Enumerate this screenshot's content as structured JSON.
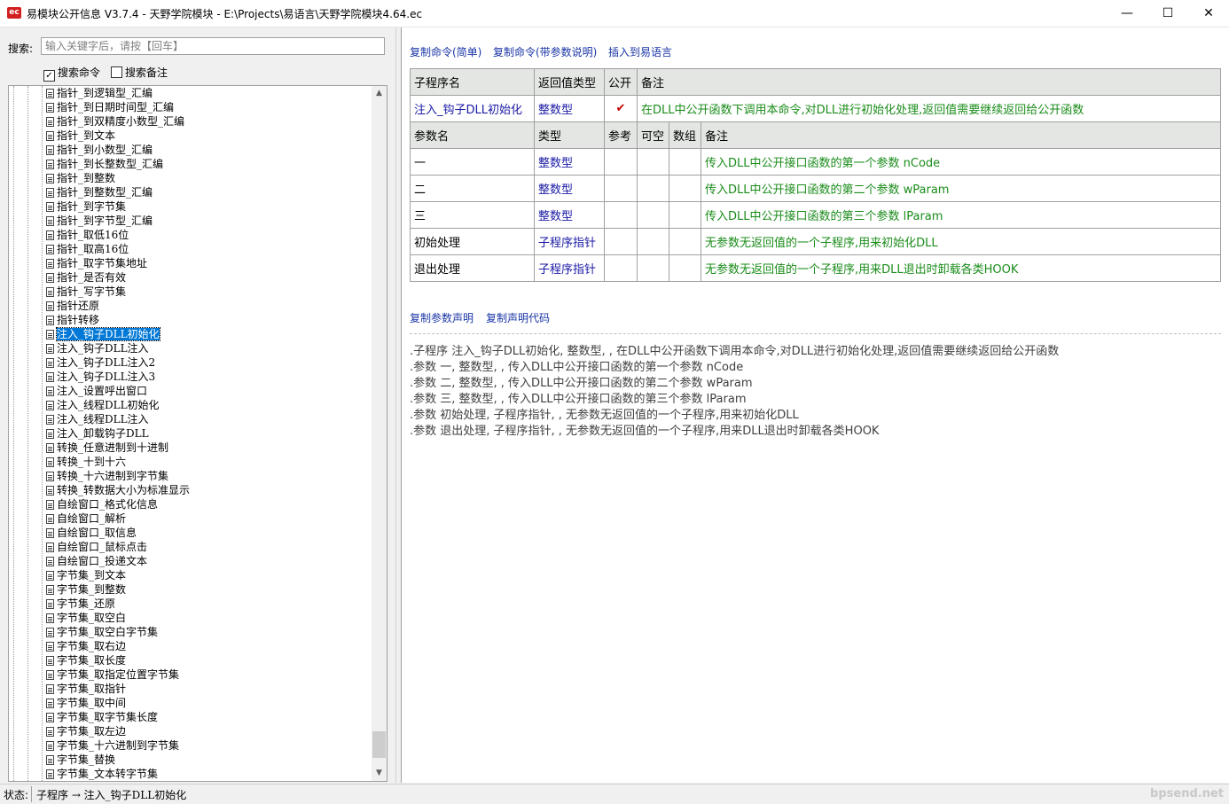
{
  "window": {
    "icon_text": "ec",
    "title": "易模块公开信息 V3.7.4 - 天野学院模块 - E:\\Projects\\易语言\\天野学院模块4.64.ec",
    "minimize": "—",
    "maximize": "☐",
    "close": "✕"
  },
  "search": {
    "label": "搜索:",
    "placeholder": "输入关键字后，请按【回车】",
    "option_command": "搜索命令",
    "option_command_checked": "✓",
    "option_note": "搜索备注"
  },
  "tree": {
    "items": [
      "指针_到逻辑型_汇编",
      "指针_到日期时间型_汇编",
      "指针_到双精度小数型_汇编",
      "指针_到文本",
      "指针_到小数型_汇编",
      "指针_到长整数型_汇编",
      "指针_到整数",
      "指针_到整数型_汇编",
      "指针_到字节集",
      "指针_到字节型_汇编",
      "指针_取低16位",
      "指针_取高16位",
      "指针_取字节集地址",
      "指针_是否有效",
      "指针_写字节集",
      "指针还原",
      "指针转移",
      "注入_钩子DLL初始化",
      "注入_钩子DLL注入",
      "注入_钩子DLL注入2",
      "注入_钩子DLL注入3",
      "注入_设置呼出窗口",
      "注入_线程DLL初始化",
      "注入_线程DLL注入",
      "注入_卸载钩子DLL",
      "转换_任意进制到十进制",
      "转换_十到十六",
      "转换_十六进制到字节集",
      "转换_转数据大小为标准显示",
      "自绘窗口_格式化信息",
      "自绘窗口_解析",
      "自绘窗口_取信息",
      "自绘窗口_鼠标点击",
      "自绘窗口_投递文本",
      "字节集_到文本",
      "字节集_到整数",
      "字节集_还原",
      "字节集_取空白",
      "字节集_取空白字节集",
      "字节集_取右边",
      "字节集_取长度",
      "字节集_取指定位置字节集",
      "字节集_取指针",
      "字节集_取中间",
      "字节集_取字节集长度",
      "字节集_取左边",
      "字节集_十六进制到字节集",
      "字节集_替换",
      "字节集_文本转字节集"
    ],
    "selected": "注入_钩子DLL初始化",
    "scroll_up": "▲",
    "scroll_down": "▼"
  },
  "actions": {
    "copy_simple": "复制命令(简单)",
    "copy_with_params": "复制命令(带参数说明)",
    "insert": "插入到易语言",
    "copy_param_decl": "复制参数声明",
    "copy_decl_code": "复制声明代码"
  },
  "detail": {
    "headers": {
      "name": "子程序名",
      "return_type": "返回值类型",
      "public": "公开",
      "note": "备注"
    },
    "routine": {
      "name": "注入_钩子DLL初始化",
      "return_type": "整数型",
      "public": "✔",
      "note": "在DLL中公开函数下调用本命令,对DLL进行初始化处理,返回值需要继续返回给公开函数"
    },
    "param_headers": {
      "name": "参数名",
      "type": "类型",
      "ref": "参考",
      "nullable": "可空",
      "array": "数组",
      "note": "备注"
    },
    "params": [
      {
        "name": "一",
        "type": "整数型",
        "note": "传入DLL中公开接口函数的第一个参数 nCode"
      },
      {
        "name": "二",
        "type": "整数型",
        "note": "传入DLL中公开接口函数的第二个参数 wParam"
      },
      {
        "name": "三",
        "type": "整数型",
        "note": "传入DLL中公开接口函数的第三个参数 lParam"
      },
      {
        "name": "初始处理",
        "type": "子程序指针",
        "note": "无参数无返回值的一个子程序,用来初始化DLL"
      },
      {
        "name": "退出处理",
        "type": "子程序指针",
        "note": "无参数无返回值的一个子程序,用来DLL退出时卸载各类HOOK"
      }
    ]
  },
  "code": [
    ".子程序 注入_钩子DLL初始化, 整数型, , 在DLL中公开函数下调用本命令,对DLL进行初始化处理,返回值需要继续返回给公开函数",
    ".参数 一, 整数型, , 传入DLL中公开接口函数的第一个参数 nCode",
    ".参数 二, 整数型, , 传入DLL中公开接口函数的第二个参数 wParam",
    ".参数 三, 整数型, , 传入DLL中公开接口函数的第三个参数 lParam",
    ".参数 初始处理, 子程序指针, , 无参数无返回值的一个子程序,用来初始化DLL",
    ".参数 退出处理, 子程序指针, , 无参数无返回值的一个子程序,用来DLL退出时卸载各类HOOK"
  ],
  "status": {
    "label": "状态:",
    "value": "子程序 → 注入_钩子DLL初始化",
    "watermark": "bpsend.net"
  }
}
